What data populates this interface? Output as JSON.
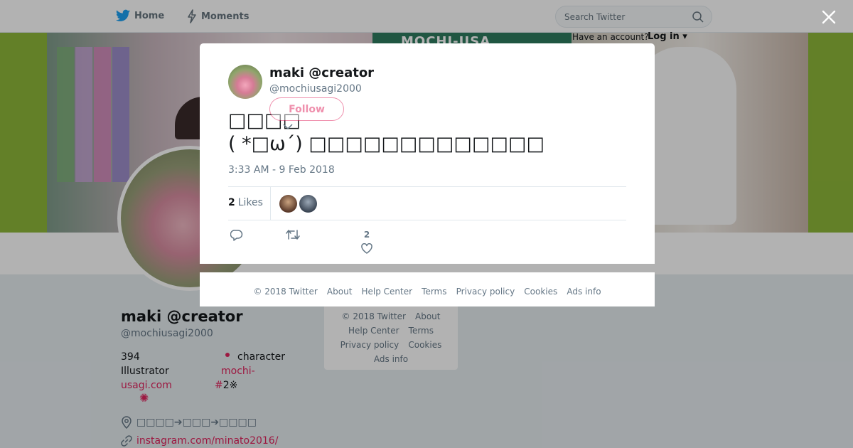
{
  "nav": {
    "home_label": "Home",
    "moments_label": "Moments",
    "search_placeholder": "Search Twitter",
    "signup_prompt": "Have an account?",
    "login_label": "Log in"
  },
  "banner": {
    "sign_text": "MOCHI-USA"
  },
  "profile": {
    "name": "maki @creator",
    "handle": "@mochiusagi2000",
    "bio": {
      "count": "394",
      "role": "Illustrator",
      "link_part1": "mochi-",
      "link_part2": "usagi.com",
      "character_label": "character",
      "hash": "#",
      "extra": "2※",
      "mark": "✺"
    },
    "location": "□□□□➔□□□➔□□□□",
    "website": "instagram.com/minato2016/"
  },
  "side_footer": {
    "items": [
      "© 2018 Twitter",
      "About",
      "Help Center",
      "Terms",
      "Privacy policy",
      "Cookies",
      "Ads info"
    ]
  },
  "tweet": {
    "author_name": "maki @creator",
    "author_handle": "@mochiusagi2000",
    "follow_label": "Follow",
    "text_line1": "□□□□",
    "text_line2": "( *□ω´) □□□□□□□□□□□□□",
    "timestamp": "3:33 AM - 9 Feb 2018",
    "likes_count": "2",
    "likes_label": "Likes",
    "like_action_count": "2"
  },
  "modal_footer": {
    "items": [
      "© 2018 Twitter",
      "About",
      "Help Center",
      "Terms",
      "Privacy policy",
      "Cookies",
      "Ads info"
    ]
  },
  "colors": {
    "accent": "#e0245e",
    "twitter_blue": "#1da1f2",
    "banner_green": "#8fb83a"
  },
  "icons": [
    "twitter-bird-icon",
    "lightning-icon",
    "search-icon",
    "close-icon",
    "reply-icon",
    "retweet-icon",
    "heart-icon",
    "chevron-down-icon",
    "location-pin-icon",
    "link-icon"
  ]
}
